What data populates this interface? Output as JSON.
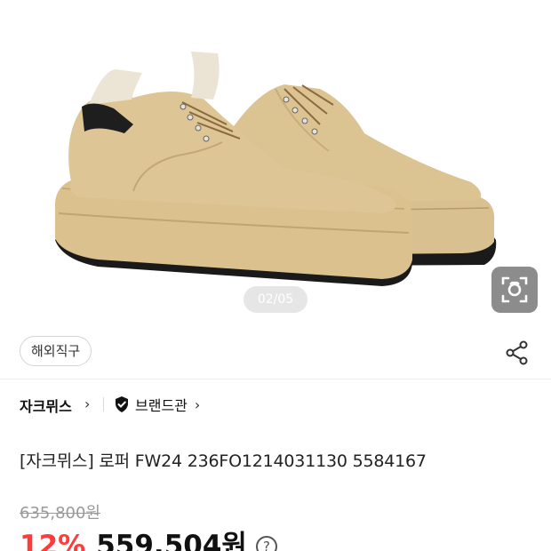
{
  "gallery": {
    "indicator": "02/05",
    "current_page": 2,
    "total_pages": 5,
    "image_subject": "tan suede derby shoes with thick gum sole",
    "lens_icon": "image-search-icon"
  },
  "tags": {
    "overseas": "해외직구",
    "share_icon": "share-icon"
  },
  "brand": {
    "name": "자크뮈스",
    "brand_hall": "브랜드관",
    "badge_icon": "verified-shield-icon",
    "chevron_icon": "chevron-right-icon"
  },
  "product": {
    "title": "[자크뮈스] 로퍼 FW24 236FO1214031130 5584167"
  },
  "price": {
    "original": "635,800원",
    "discount": "12%",
    "sale": "559,504원",
    "info_icon": "help-icon",
    "info_glyph": "?"
  },
  "colors": {
    "discount": "#ff3b3b",
    "suede": "#d9bf8a",
    "sole": "#1a1a1a"
  }
}
